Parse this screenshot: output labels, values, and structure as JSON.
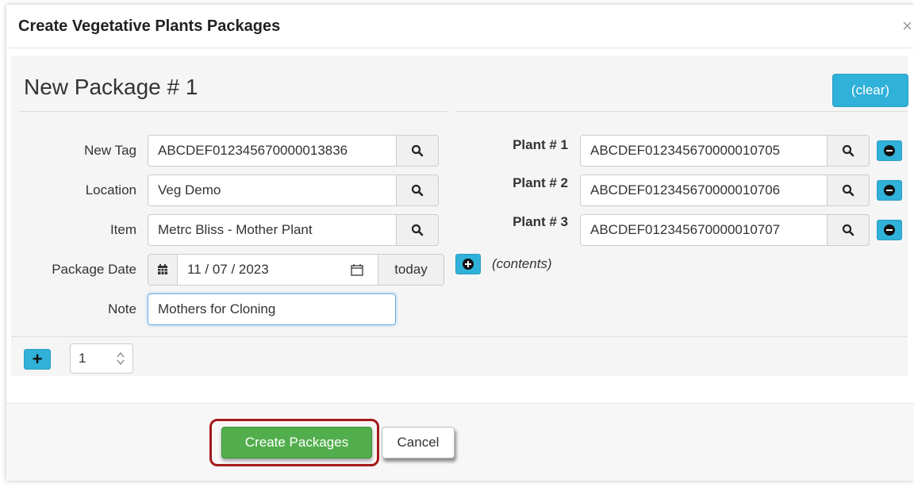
{
  "dialog": {
    "title": "Create Vegetative Plants Packages",
    "close_glyph": "×"
  },
  "package": {
    "heading": "New Package # 1",
    "clear_label": "(clear)",
    "fields": {
      "new_tag": {
        "label": "New Tag",
        "value": "ABCDEF012345670000013836"
      },
      "location": {
        "label": "Location",
        "value": "Veg Demo"
      },
      "item": {
        "label": "Item",
        "value": "Metrc Bliss - Mother Plant"
      },
      "package_date": {
        "label": "Package Date",
        "value": "11 / 07 / 2023",
        "today_label": "today"
      },
      "note": {
        "label": "Note",
        "value": "Mothers for Cloning"
      }
    },
    "plants": [
      {
        "label": "Plant # 1",
        "value": "ABCDEF012345670000010705"
      },
      {
        "label": "Plant # 2",
        "value": "ABCDEF012345670000010706"
      },
      {
        "label": "Plant # 3",
        "value": "ABCDEF012345670000010707"
      }
    ],
    "contents_label": "(contents)"
  },
  "add_packages": {
    "count": "1"
  },
  "footer": {
    "create_label": "Create Packages",
    "cancel_label": "Cancel"
  },
  "colors": {
    "info_blue": "#2fb1d9",
    "success_green": "#52ae4c",
    "highlight_red": "#a51919"
  },
  "icons": {
    "search": "search-icon",
    "calendar": "calendar-icon",
    "minus": "minus-circle-icon",
    "plus": "plus-circle-icon"
  }
}
